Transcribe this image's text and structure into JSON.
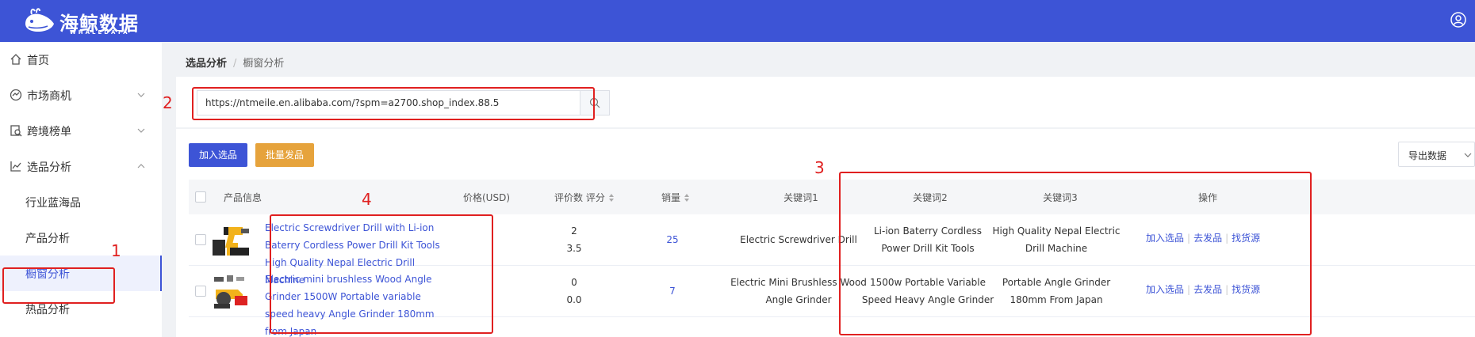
{
  "header": {
    "brand": "海鲸数据",
    "brand_sub": "WHALEDATA"
  },
  "sidebar": {
    "items": [
      {
        "label": "首页",
        "icon": "home-icon"
      },
      {
        "label": "市场商机",
        "icon": "chart-icon"
      },
      {
        "label": "跨境榜单",
        "icon": "rank-icon"
      },
      {
        "label": "选品分析",
        "icon": "analysis-icon"
      },
      {
        "label": "行业蓝海品"
      },
      {
        "label": "产品分析"
      },
      {
        "label": "橱窗分析",
        "active": true
      },
      {
        "label": "热品分析"
      }
    ]
  },
  "breadcrumb": {
    "level1": "选品分析",
    "separator": "/",
    "level2": "橱窗分析"
  },
  "search": {
    "value": "https://ntmeile.en.alibaba.com/?spm=a2700.shop_index.88.5"
  },
  "toolbar": {
    "add_label": "加入选品",
    "batch_label": "批量发品",
    "export_label": "导出数据"
  },
  "table": {
    "headers": {
      "product": "产品信息",
      "price": "价格(USD)",
      "reviews": "评价数 评分",
      "sales": "销量",
      "kw1": "关键词1",
      "kw2": "关键词2",
      "kw3": "关键词3",
      "ops": "操作"
    },
    "rows": [
      {
        "title": "Electric Screwdriver Drill with Li-ion Baterry Cordless Power Drill Kit Tools High Quality Nepal Electric Drill Machine",
        "reviews": "2",
        "rating": "3.5",
        "sales": "25",
        "kw1": "Electric Screwdriver Drill",
        "kw2": "Li-ion Baterry Cordless Power Drill Kit Tools",
        "kw3": "High Quality Nepal Electric Drill Machine"
      },
      {
        "title": "Electric mini brushless Wood Angle Grinder 1500W Portable variable speed heavy Angle Grinder 180mm from Japan",
        "reviews": "0",
        "rating": "0.0",
        "sales": "7",
        "kw1": "Electric Mini Brushless Wood Angle Grinder",
        "kw2": "1500w Portable Variable Speed Heavy Angle Grinder",
        "kw3": "Portable Angle Grinder 180mm From Japan"
      }
    ],
    "ops": {
      "add": "加入选品",
      "publish": "去发品",
      "source": "找货源"
    }
  },
  "annotations": [
    "1",
    "2",
    "3",
    "4"
  ],
  "colors": {
    "primary": "#3d54d6",
    "orange": "#e6a33c",
    "annotation": "#e02020"
  }
}
